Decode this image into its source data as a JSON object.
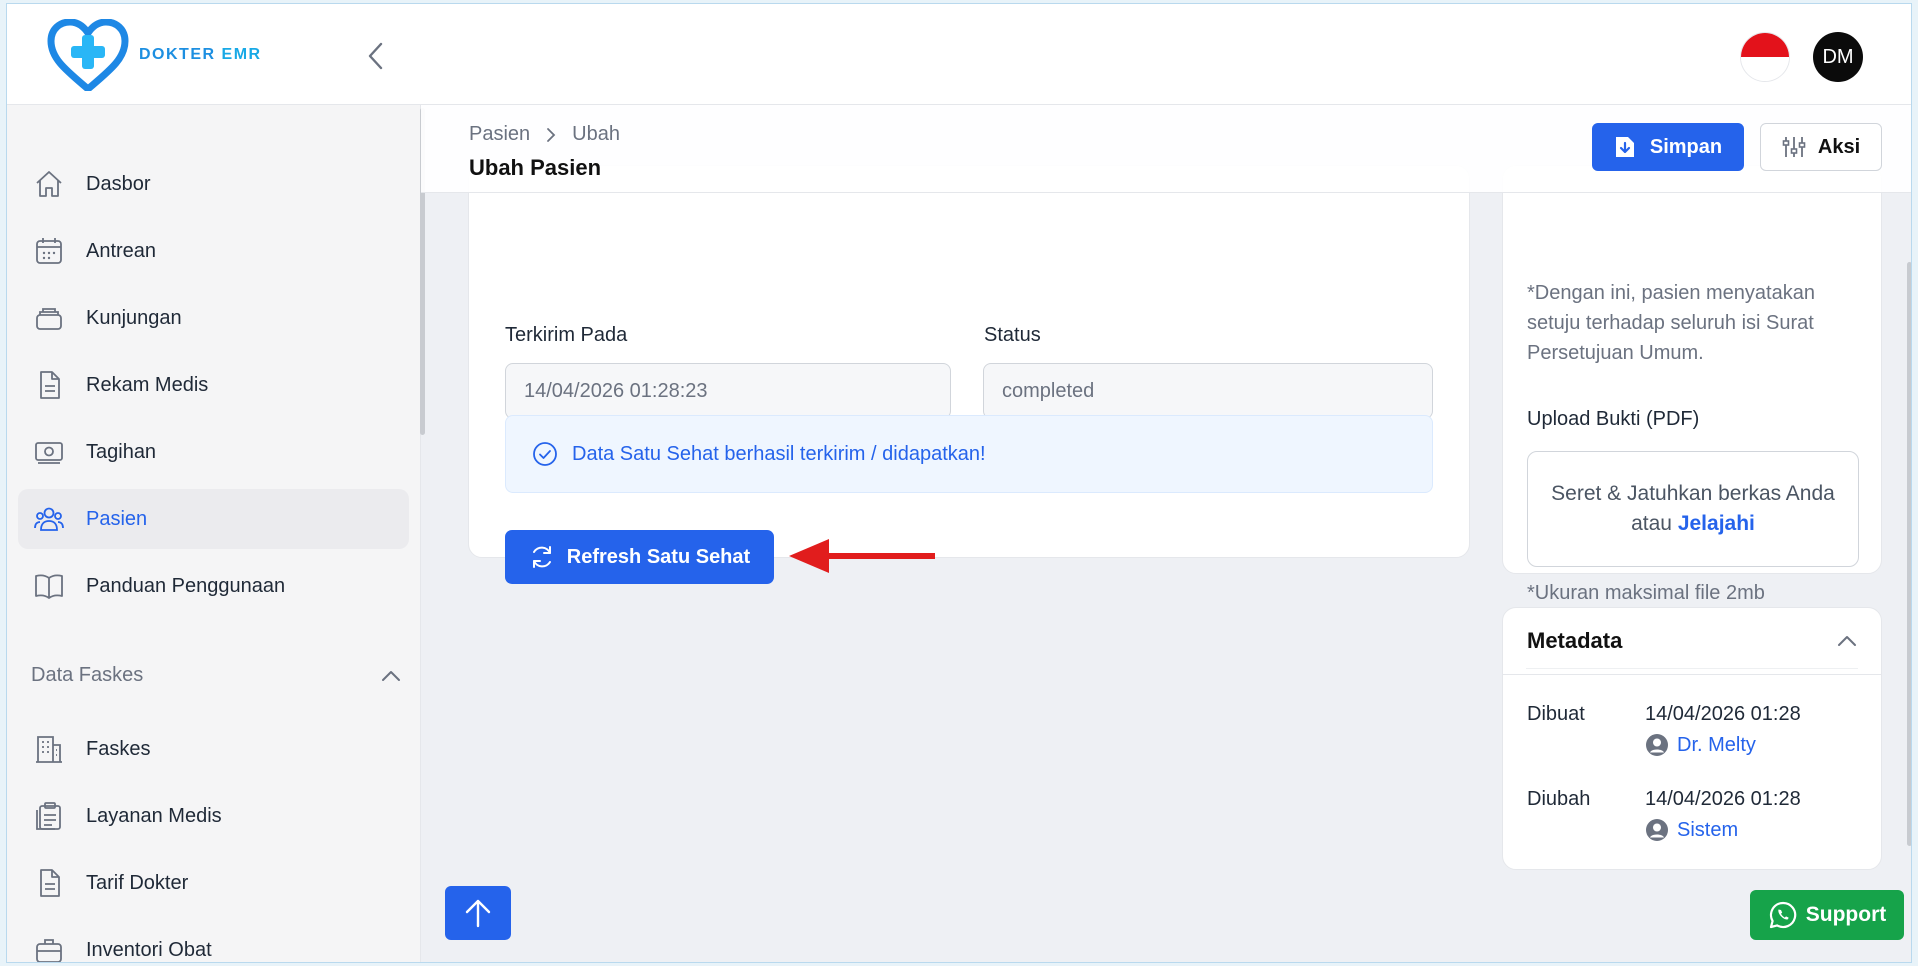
{
  "app": {
    "logo_text_main": "DOKTER",
    "logo_text_accent": "EMR",
    "avatar_initials": "DM",
    "language_flag": "indonesia-flag"
  },
  "sidebar": {
    "items": [
      {
        "label": "Dasbor",
        "icon": "home-icon"
      },
      {
        "label": "Antrean",
        "icon": "calendar-icon"
      },
      {
        "label": "Kunjungan",
        "icon": "layers-icon"
      },
      {
        "label": "Rekam Medis",
        "icon": "document-icon"
      },
      {
        "label": "Tagihan",
        "icon": "cash-icon"
      },
      {
        "label": "Pasien",
        "icon": "users-icon",
        "active": true
      },
      {
        "label": "Panduan Penggunaan",
        "icon": "book-icon"
      }
    ],
    "section_title": "Data Faskes",
    "section_items": [
      {
        "label": "Faskes",
        "icon": "building-icon"
      },
      {
        "label": "Layanan Medis",
        "icon": "clipboard-icon"
      },
      {
        "label": "Tarif Dokter",
        "icon": "document-icon"
      },
      {
        "label": "Inventori Obat",
        "icon": "briefcase-icon"
      }
    ]
  },
  "header": {
    "breadcrumb": [
      "Pasien",
      "Ubah"
    ],
    "title": "Ubah Pasien",
    "save_label": "Simpan",
    "aksi_label": "Aksi"
  },
  "satusehat": {
    "sent_at_label": "Terkirim Pada",
    "sent_at_value": "14/04/2026 01:28:23",
    "status_label": "Status",
    "status_value": "completed",
    "alert_text": "Data Satu Sehat berhasil terkirim / didapatkan!",
    "refresh_label": "Refresh Satu Sehat"
  },
  "consent": {
    "text": "*Dengan ini, pasien menyatakan setuju terhadap seluruh isi Surat Persetujuan Umum.",
    "upload_label": "Upload Bukti (PDF)",
    "dropzone_text": "Seret & Jatuhkan berkas Anda atau",
    "dropzone_link": "Jelajahi",
    "upload_note": "*Ukuran maksimal file 2mb"
  },
  "metadata": {
    "title": "Metadata",
    "created_label": "Dibuat",
    "created_date": "14/04/2026 01:28",
    "created_by": "Dr. Melty",
    "updated_label": "Diubah",
    "updated_date": "14/04/2026 01:28",
    "updated_by": "Sistem"
  },
  "support_label": "Support",
  "colors": {
    "primary": "#2563eb",
    "support": "#16a34a",
    "annotation_arrow": "#e11d1d"
  }
}
